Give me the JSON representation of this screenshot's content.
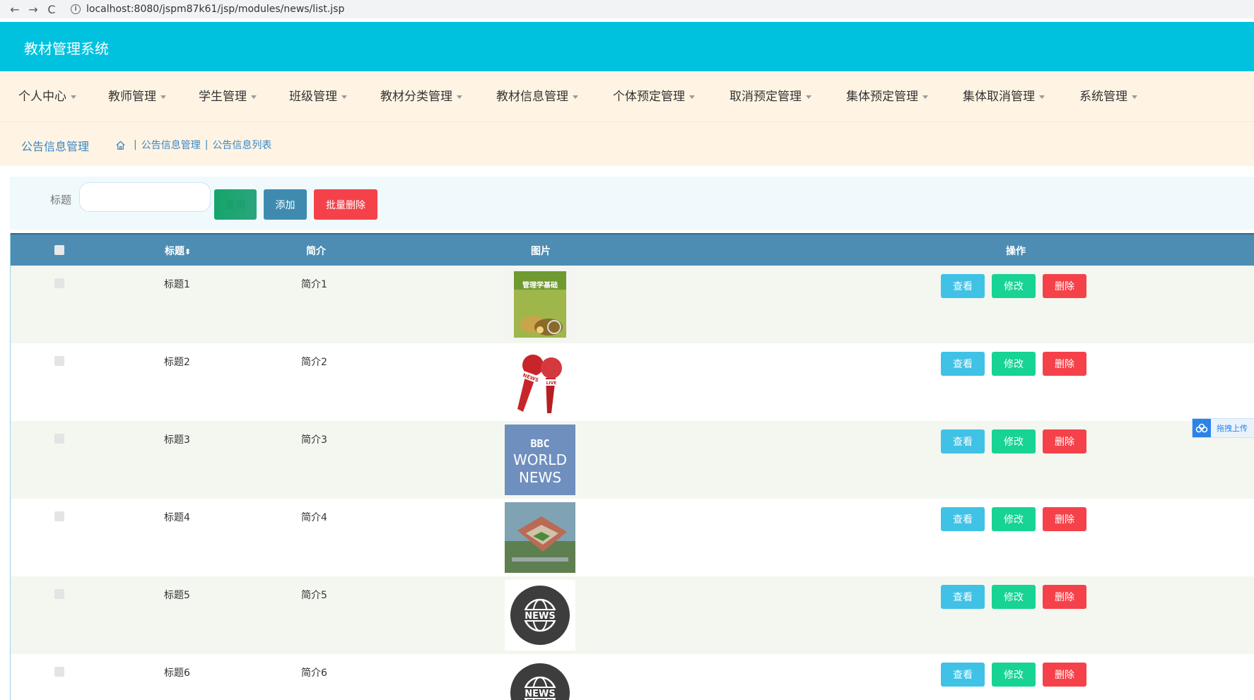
{
  "browser": {
    "url": "localhost:8080/jspm87k61/jsp/modules/news/list.jsp",
    "back": "←",
    "forward": "→",
    "reload": "C",
    "info": "i"
  },
  "header": {
    "title": "教材管理系统"
  },
  "nav": {
    "items": [
      "个人中心",
      "教师管理",
      "学生管理",
      "班级管理",
      "教材分类管理",
      "教材信息管理",
      "个体预定管理",
      "取消预定管理",
      "集体预定管理",
      "集体取消管理",
      "系统管理"
    ]
  },
  "breadcrumb": {
    "title": "公告信息管理",
    "path": [
      "公告信息管理",
      "公告信息列表"
    ],
    "separator": "|"
  },
  "search": {
    "label": "标题",
    "query_button": "查询",
    "add_button": "添加",
    "batch_delete_button": "批量删除"
  },
  "table": {
    "headers": {
      "title": "标题",
      "sort_icon": "⬍",
      "desc": "简介",
      "pic": "图片",
      "op": "操作"
    },
    "rows": [
      {
        "title": "标题1",
        "desc": "简介1",
        "image": "textbook-cover"
      },
      {
        "title": "标题2",
        "desc": "简介2",
        "image": "microphones"
      },
      {
        "title": "标题3",
        "desc": "简介3",
        "image": "bbc-world-news"
      },
      {
        "title": "标题4",
        "desc": "简介4",
        "image": "building-aerial"
      },
      {
        "title": "标题5",
        "desc": "简介5",
        "image": "news-globe"
      },
      {
        "title": "标题6",
        "desc": "简介6",
        "image": "news-globe"
      }
    ],
    "actions": {
      "view": "查看",
      "edit": "修改",
      "delete": "删除"
    }
  },
  "images": {
    "textbook_text": "管理学基础",
    "mic_tag_1": "NEWS",
    "mic_tag_2": "LIVE",
    "bbc_line1": "BBC",
    "bbc_line2": "WORLD",
    "bbc_line3": "NEWS",
    "globe_text": "NEWS"
  },
  "float_widget": {
    "text": "拖拽上传"
  },
  "colors": {
    "header": "#00c2de",
    "nav_bg": "#fff4e4",
    "thead": "#4e8db3",
    "view": "#3fc2e6",
    "edit": "#17d394",
    "delete": "#f5424a"
  }
}
